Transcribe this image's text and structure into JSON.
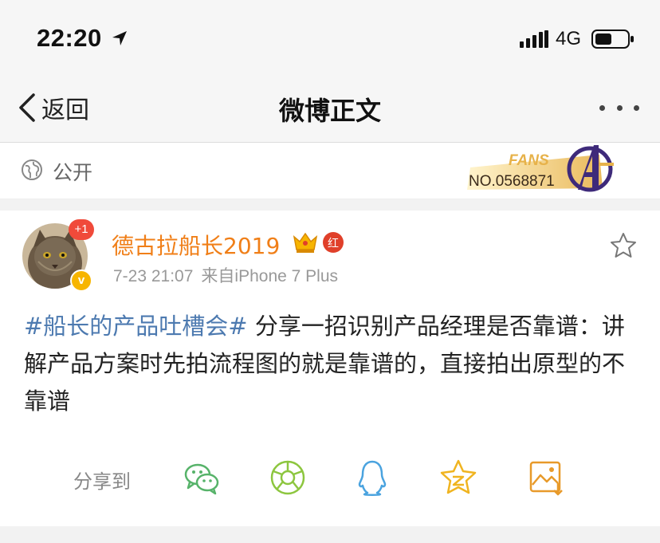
{
  "status_bar": {
    "time": "22:20",
    "network": "4G"
  },
  "nav": {
    "back_label": "返回",
    "title": "微博正文"
  },
  "visibility": {
    "label": "公开"
  },
  "fans_badge": {
    "title": "FANS",
    "number": "NO.0568871",
    "colors": {
      "gold": "#e7b24a",
      "purple": "#3e2a7a"
    }
  },
  "post": {
    "avatar_badge": "+1",
    "verified_mark": "v",
    "username": "德古拉船长2019",
    "user_badge_text": "红",
    "timestamp": "7-23 21:07",
    "source": "来自iPhone 7 Plus",
    "hashtag": "#船长的产品吐槽会#",
    "text": " 分享一招识别产品经理是否靠谱：讲解产品方案时先拍流程图的就是靠谱的，直接拍出原型的不靠谱"
  },
  "share": {
    "label": "分享到",
    "targets": [
      "wechat-icon",
      "moments-icon",
      "qq-icon",
      "qzone-icon",
      "save-image-icon"
    ]
  },
  "colors": {
    "username": "#f07f18",
    "hashtag": "#4d7ab0",
    "share_green": "#57b36a",
    "share_blue": "#4aa3df",
    "share_yellow": "#f0b420",
    "share_orange": "#e89a2a"
  }
}
